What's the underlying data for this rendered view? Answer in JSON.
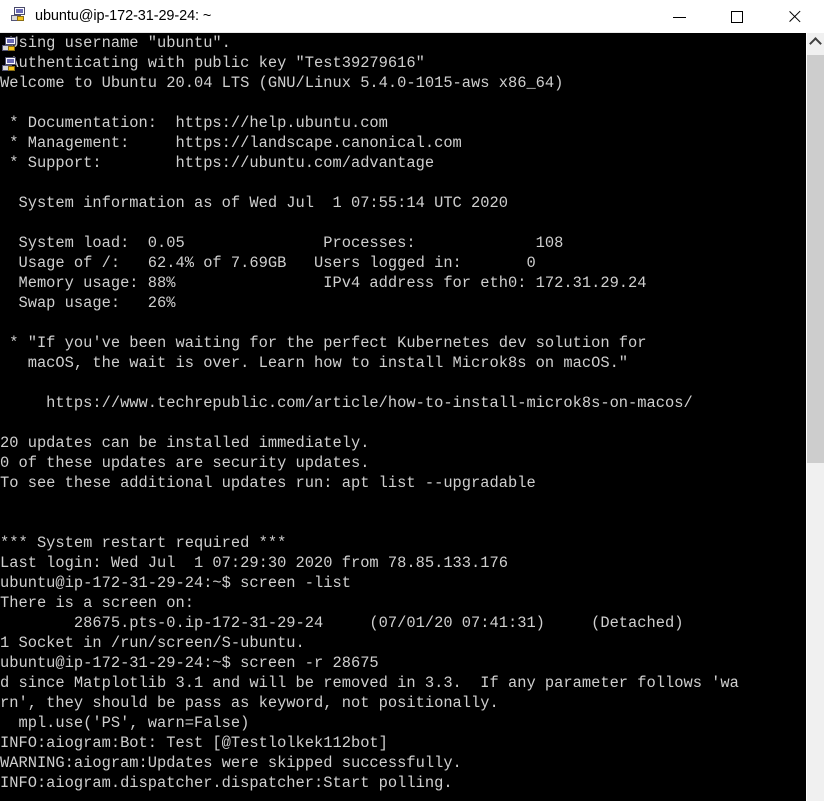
{
  "window": {
    "title": "ubuntu@ip-172-31-29-24: ~",
    "icon": "putty-computer-icon",
    "controls": {
      "minimize": "minimize-icon",
      "maximize": "maximize-icon",
      "close": "close-icon"
    }
  },
  "scrollbar": {
    "up_arrow": "chevron-up-icon"
  },
  "terminal": {
    "background_color": "#000000",
    "foreground_color": "#cfcfcf",
    "lines": [
      " Using username \"ubuntu\".",
      " Authenticating with public key \"Test39279616\"",
      "Welcome to Ubuntu 20.04 LTS (GNU/Linux 5.4.0-1015-aws x86_64)",
      "",
      " * Documentation:  https://help.ubuntu.com",
      " * Management:     https://landscape.canonical.com",
      " * Support:        https://ubuntu.com/advantage",
      "",
      "  System information as of Wed Jul  1 07:55:14 UTC 2020",
      "",
      "  System load:  0.05               Processes:             108",
      "  Usage of /:   62.4% of 7.69GB   Users logged in:       0",
      "  Memory usage: 88%                IPv4 address for eth0: 172.31.29.24",
      "  Swap usage:   26%",
      "",
      " * \"If you've been waiting for the perfect Kubernetes dev solution for",
      "   macOS, the wait is over. Learn how to install Microk8s on macOS.\"",
      "",
      "     https://www.techrepublic.com/article/how-to-install-microk8s-on-macos/",
      "",
      "20 updates can be installed immediately.",
      "0 of these updates are security updates.",
      "To see these additional updates run: apt list --upgradable",
      "",
      "",
      "*** System restart required ***",
      "Last login: Wed Jul  1 07:29:30 2020 from 78.85.133.176",
      "ubuntu@ip-172-31-29-24:~$ screen -list",
      "There is a screen on:",
      "        28675.pts-0.ip-172-31-29-24     (07/01/20 07:41:31)     (Detached)",
      "1 Socket in /run/screen/S-ubuntu.",
      "ubuntu@ip-172-31-29-24:~$ screen -r 28675",
      "d since Matplotlib 3.1 and will be removed in 3.3.  If any parameter follows 'wa",
      "rn', they should be pass as keyword, not positionally.",
      "  mpl.use('PS', warn=False)",
      "INFO:aiogram:Bot: Test [@Testlolkek112bot]",
      "WARNING:aiogram:Updates were skipped successfully.",
      "INFO:aiogram.dispatcher.dispatcher:Start polling."
    ]
  }
}
